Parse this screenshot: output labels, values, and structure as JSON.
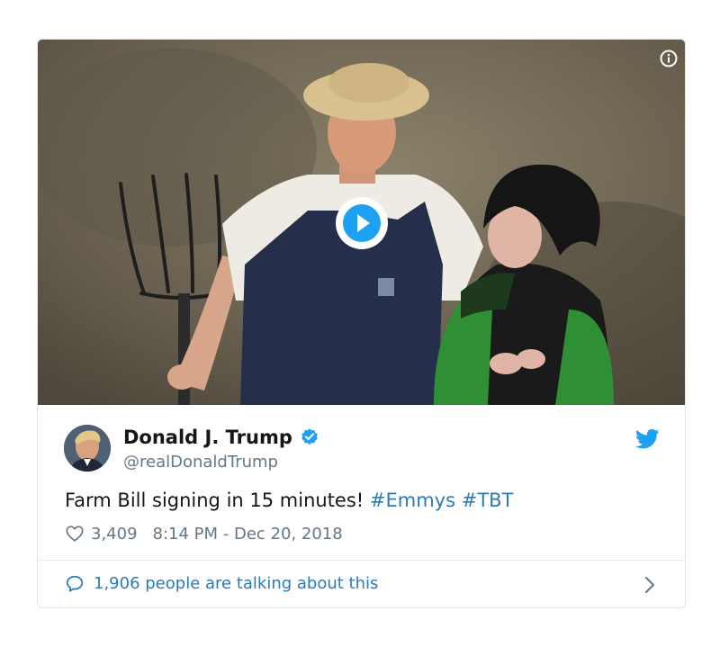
{
  "tweet": {
    "author": {
      "display_name": "Donald J. Trump",
      "handle": "@realDonaldTrump",
      "verified": true
    },
    "text_prefix": "Farm Bill signing in 15 minutes!",
    "hashtags": [
      "#Emmys",
      "#TBT"
    ],
    "likes": "3,409",
    "timestamp": "8:14 PM - Dec 20, 2018",
    "conversation": "1,906 people are talking about this"
  },
  "icons": {
    "info": "info-circle-icon",
    "play": "play-icon",
    "verified": "verified-badge-icon",
    "brand": "twitter-bird-icon",
    "like": "heart-icon",
    "reply": "chat-bubble-icon",
    "more": "chevron-right-icon"
  },
  "colors": {
    "link": "#2b7bb9",
    "verified": "#1da1f2",
    "text": "#14171a",
    "muted": "#657786",
    "border": "#e1e8ed"
  }
}
